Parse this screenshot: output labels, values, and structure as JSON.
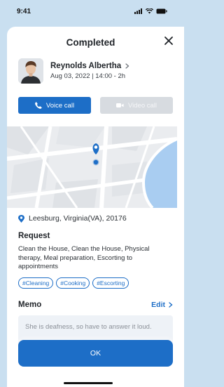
{
  "status": {
    "time": "9:41"
  },
  "header": {
    "title": "Completed"
  },
  "profile": {
    "name": "Reynolds Albertha",
    "schedule": "Aug 03, 2022  |  14:00 - 2h"
  },
  "calls": {
    "voice_label": "Voice call",
    "video_label": "Video call"
  },
  "location": {
    "address": "Leesburg, Virginia(VA), 20176"
  },
  "request": {
    "title": "Request",
    "description": "Clean the House, Clean the House, Physical therapy, Meal preparation, Escorting to appointments",
    "tags": [
      "#Cleaning",
      "#Cooking",
      "#Escorting"
    ]
  },
  "memo": {
    "title": "Memo",
    "edit_label": "Edit",
    "text": "She is deafness, so have to answer it loud."
  },
  "footer": {
    "ok_label": "OK"
  },
  "colors": {
    "accent": "#1d6ec7",
    "background": "#c9dff0",
    "disabled": "#d7dbe0"
  }
}
